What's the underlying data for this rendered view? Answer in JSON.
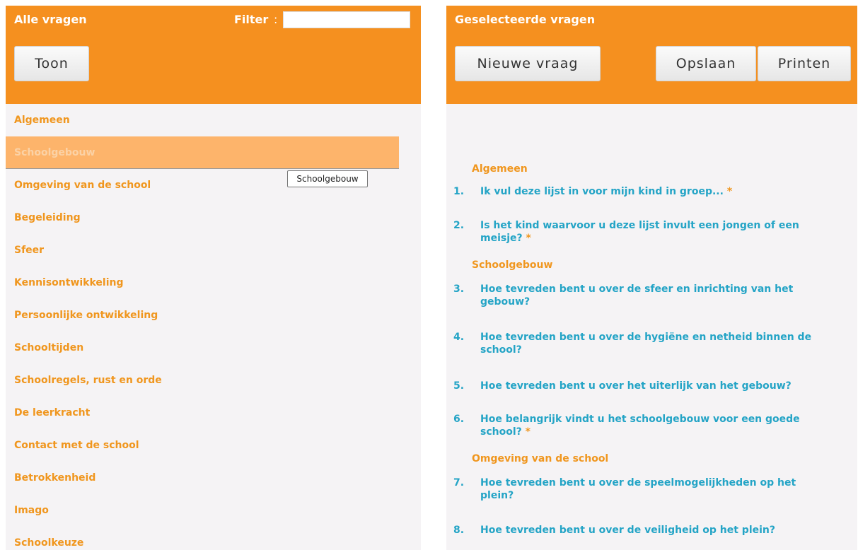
{
  "left": {
    "title": "Alle vragen",
    "filter_label": "Filter",
    "filter_colon": ":",
    "filter_value": "",
    "show_button": "Toon",
    "categories": [
      "Algemeen",
      "Schoolgebouw",
      "Omgeving van de school",
      "Begeleiding",
      "Sfeer",
      "Kennisontwikkeling",
      "Persoonlijke ontwikkeling",
      "Schooltijden",
      "Schoolregels, rust en orde",
      "De leerkracht",
      "Contact met de school",
      "Betrokkenheid",
      "Imago",
      "Schoolkeuze"
    ],
    "active_category": "Schoolgebouw",
    "tooltip": "Schoolgebouw"
  },
  "right": {
    "title": "Geselecteerde vragen",
    "new_question_button": "Nieuwe vraag",
    "save_button": "Opslaan",
    "print_button": "Printen",
    "groups": [
      {
        "title": "Algemeen",
        "questions": [
          {
            "num": "1.",
            "text": "Ik vul deze lijst in voor mijn kind in groep...",
            "required": "*"
          },
          {
            "num": "2.",
            "text": "Is het kind waarvoor u deze lijst invult een jongen of een meisje?",
            "required": "*"
          }
        ]
      },
      {
        "title": "Schoolgebouw",
        "questions": [
          {
            "num": "3.",
            "text": "Hoe tevreden bent u over de sfeer en inrichting van het gebouw?",
            "required": ""
          },
          {
            "num": "4.",
            "text": "Hoe tevreden bent u over de hygiëne en netheid binnen de school?",
            "required": ""
          },
          {
            "num": "5.",
            "text": "Hoe tevreden bent u over het uiterlijk van het gebouw?",
            "required": ""
          },
          {
            "num": "6.",
            "text": "Hoe belangrijk vindt u het schoolgebouw voor een goede school?",
            "required": "*"
          }
        ]
      },
      {
        "title": "Omgeving van de school",
        "questions": [
          {
            "num": "7.",
            "text": "Hoe tevreden bent u over de speelmogelijkheden op het plein?",
            "required": ""
          },
          {
            "num": "8.",
            "text": "Hoe tevreden bent u over de veiligheid op het plein?",
            "required": ""
          }
        ]
      }
    ]
  },
  "colors": {
    "header_orange": "#f5901f",
    "category_text": "#f0961e",
    "question_text": "#24a4c6",
    "active_highlight": "#fdb46b"
  }
}
